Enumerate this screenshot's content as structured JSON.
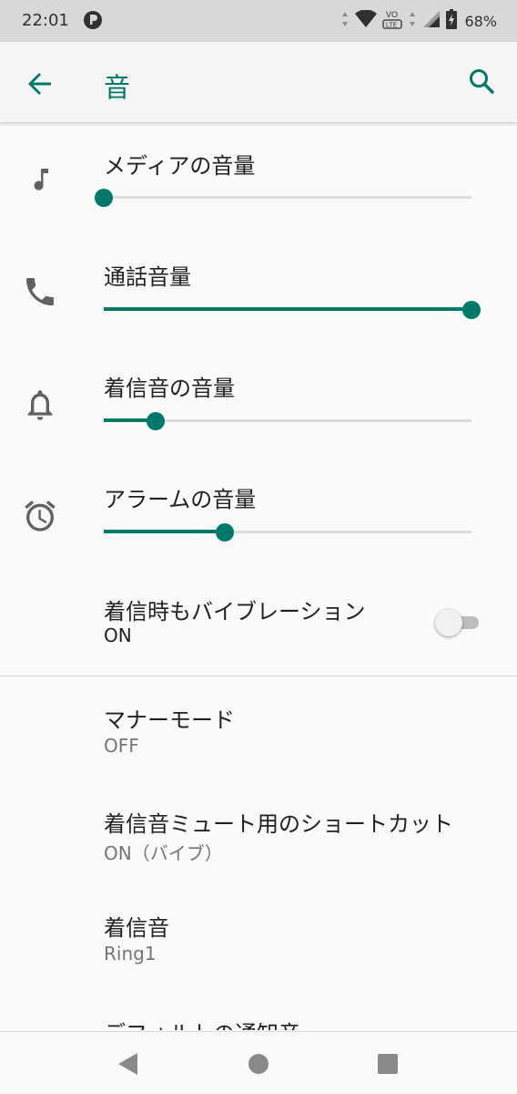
{
  "status_bar": {
    "time": "22:01",
    "notification_icon": "p-app-icon",
    "battery_percent": "68%",
    "icons": [
      "data-arrows-icon",
      "wifi-icon",
      "volte-icon",
      "signal-icon",
      "battery-charging-icon"
    ]
  },
  "app_bar": {
    "title": "音",
    "back_icon": "arrow-back-icon",
    "search_icon": "search-icon"
  },
  "volume_sliders": [
    {
      "label": "メディアの音量",
      "icon": "music-note-icon",
      "level": 0.0
    },
    {
      "label": "通話音量",
      "icon": "phone-icon",
      "level": 1.0
    },
    {
      "label": "着信音の音量",
      "icon": "bell-icon",
      "level": 0.14
    },
    {
      "label": "アラームの音量",
      "icon": "alarm-clock-icon",
      "level": 0.33
    }
  ],
  "vibrate_when_ringing": {
    "title": "着信時もバイブレーション",
    "summary": "ON",
    "toggle_on": false
  },
  "preferences": [
    {
      "title": "マナーモード",
      "summary": "OFF"
    },
    {
      "title": "着信音ミュート用のショートカット",
      "summary": "ON（バイブ）"
    },
    {
      "title": "着信音",
      "summary": "Ring1"
    },
    {
      "title": "デフォルトの通知音",
      "summary": ""
    }
  ],
  "nav_bar": {
    "back_icon": "nav-back-icon",
    "home_icon": "nav-home-icon",
    "recents_icon": "nav-recents-icon"
  },
  "colors": {
    "accent": "#00796b",
    "status_bar_bg": "#d8d8d8",
    "app_bar_bg": "#f5f5f5",
    "background": "#fafafa"
  }
}
